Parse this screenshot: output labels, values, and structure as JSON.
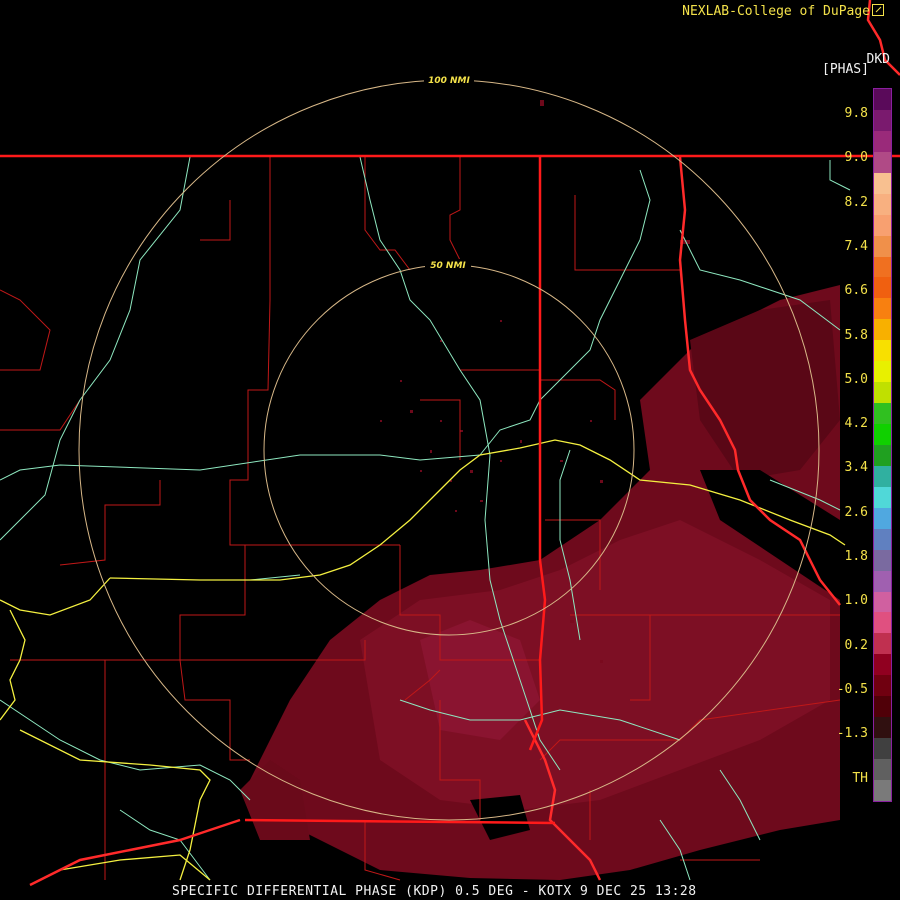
{
  "header": {
    "credit": "NEXLAB-College of DuPage",
    "station": "DKD",
    "units": "[PHAS]"
  },
  "footer": {
    "caption": "SPECIFIC DIFFERENTIAL PHASE (KDP) 0.5 DEG - KOTX 9 DEC 25 13:28"
  },
  "rings": {
    "inner_label": "50 NMI",
    "outer_label": "100 NMI"
  },
  "legend": {
    "labels": [
      "9.8",
      "9.0",
      "8.2",
      "7.4",
      "6.6",
      "5.8",
      "5.0",
      "4.2",
      "3.4",
      "2.6",
      "1.8",
      "1.0",
      "0.2",
      "-0.5",
      "-1.3",
      "TH"
    ],
    "colors": [
      "#5a0a5a",
      "#7a1a6e",
      "#9a2a7a",
      "#b04a86",
      "#f8c090",
      "#f8b080",
      "#f8a070",
      "#f0904a",
      "#f07020",
      "#f06010",
      "#f88010",
      "#f8b000",
      "#f8e000",
      "#e8f000",
      "#c0e000",
      "#30c020",
      "#10d000",
      "#20a020",
      "#30b0a0",
      "#50d8d8",
      "#50a8e0",
      "#6080c0",
      "#7a6aa0",
      "#a060b0",
      "#d060a0",
      "#e05080",
      "#c03050",
      "#900020",
      "#700010",
      "#500008",
      "#301010",
      "#404040",
      "#606060",
      "#7a7a7a"
    ],
    "colors_note_hidden": ""
  },
  "colors": {
    "state_border": "#ff1a1a",
    "county_border": "#c01818",
    "river": "#ff2a2a",
    "highway": "#f4f040",
    "road": "#8ee8c0",
    "range_ring": "#d8b888",
    "echo": "#7a0a1e"
  }
}
